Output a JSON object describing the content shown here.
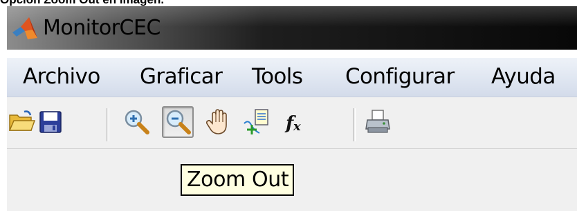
{
  "caption": "Opción Zoom Out en imagen.",
  "window": {
    "title": "MonitorCEC",
    "app_icon": "matlab-logo-icon"
  },
  "menubar": {
    "items": [
      {
        "label": "Archivo"
      },
      {
        "label": "Graficar"
      },
      {
        "label": "Tools"
      },
      {
        "label": "Configurar"
      },
      {
        "label": "Ayuda"
      }
    ]
  },
  "toolbar": {
    "buttons": [
      {
        "icon": "open-folder-icon"
      },
      {
        "icon": "save-disk-icon"
      },
      {
        "icon": "zoom-in-icon"
      },
      {
        "icon": "zoom-out-icon",
        "pressed": true
      },
      {
        "icon": "pan-hand-icon"
      },
      {
        "icon": "data-cursor-icon"
      },
      {
        "icon": "function-icon"
      },
      {
        "icon": "print-icon"
      }
    ]
  },
  "tooltip": {
    "text": "Zoom Out"
  },
  "colors": {
    "tooltip_bg": "#ffffe1",
    "menubar_bg": "#dfe6f1",
    "toolbar_bg": "#f0f0f0"
  }
}
